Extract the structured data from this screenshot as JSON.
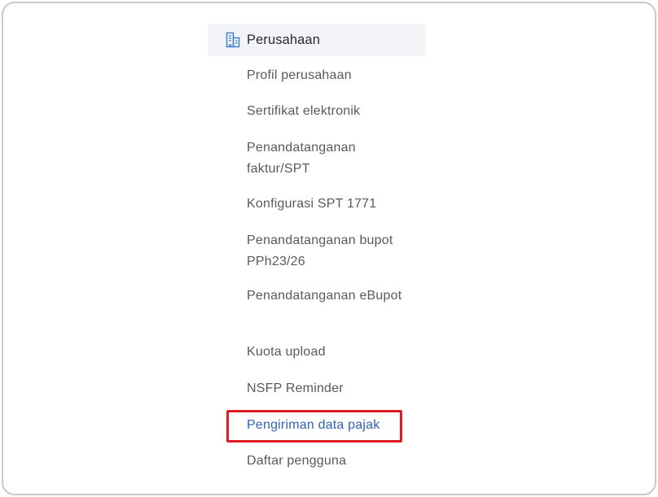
{
  "menu": {
    "header": {
      "label": "Perusahaan",
      "icon": "building-icon"
    },
    "items": [
      {
        "label": "Profil perusahaan"
      },
      {
        "label": "Sertifikat elektronik"
      },
      {
        "label": "Penandatanganan faktur/SPT"
      },
      {
        "label": "Konfigurasi SPT 1771"
      },
      {
        "label": "Penandatanganan bupot PPh23/26"
      },
      {
        "label": "Penandatanganan eBupot"
      },
      {
        "label": "Kuota upload"
      },
      {
        "label": "NSFP Reminder"
      },
      {
        "label": "Pengiriman data pajak",
        "active": true
      },
      {
        "label": "Daftar pengguna"
      }
    ]
  },
  "colors": {
    "active": "#2f62b0",
    "highlight": "#e01b24",
    "header_bg": "#f2f4f7",
    "icon": "#3b79c9"
  }
}
